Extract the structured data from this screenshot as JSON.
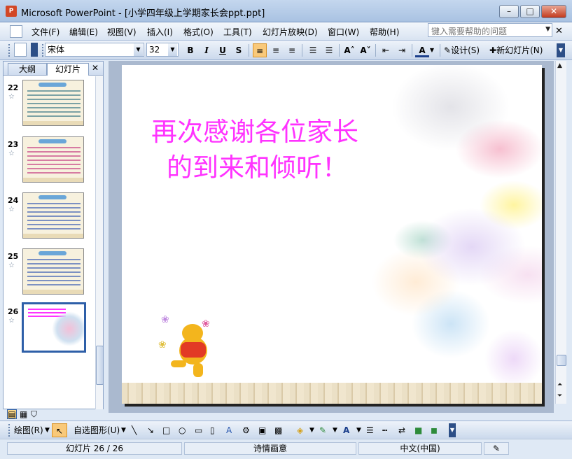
{
  "window": {
    "app_icon": "P",
    "title": "Microsoft PowerPoint - [小学四年级上学期家长会ppt.ppt]",
    "minimize": "–",
    "maximize": "□",
    "close": "✕"
  },
  "menu": {
    "items": [
      "文件(F)",
      "编辑(E)",
      "视图(V)",
      "插入(I)",
      "格式(O)",
      "工具(T)",
      "幻灯片放映(D)",
      "窗口(W)",
      "帮助(H)"
    ],
    "help_placeholder": "键入需要帮助的问题",
    "close_doc": "✕"
  },
  "toolbar": {
    "font_name": "宋体",
    "font_size": "32",
    "bold": "B",
    "italic": "I",
    "underline": "U",
    "shadow": "S",
    "grow_font": "A˄",
    "shrink_font": "A˅",
    "font_color": "A",
    "design_label": "设计(S)",
    "new_slide_label": "新幻灯片(N)"
  },
  "pane": {
    "tabs": [
      "大纲",
      "幻灯片"
    ],
    "close": "✕",
    "slides": [
      {
        "number": "22",
        "star": "☆"
      },
      {
        "number": "23",
        "star": "☆"
      },
      {
        "number": "24",
        "star": "☆"
      },
      {
        "number": "25",
        "star": "☆"
      },
      {
        "number": "26",
        "star": "☆"
      }
    ]
  },
  "slide": {
    "line1": "再次感谢各位家长",
    "line2": "的到来和倾听！"
  },
  "drawing": {
    "draw_label": "绘图(R)",
    "autoshapes_label": "自选图形(U)"
  },
  "status": {
    "slide_pos": "幻灯片 26 / 26",
    "design": "诗情画意",
    "language": "中文(中国)"
  },
  "colors": {
    "slide_text": "#ff33ff",
    "selected_border": "#2e5fa8"
  }
}
